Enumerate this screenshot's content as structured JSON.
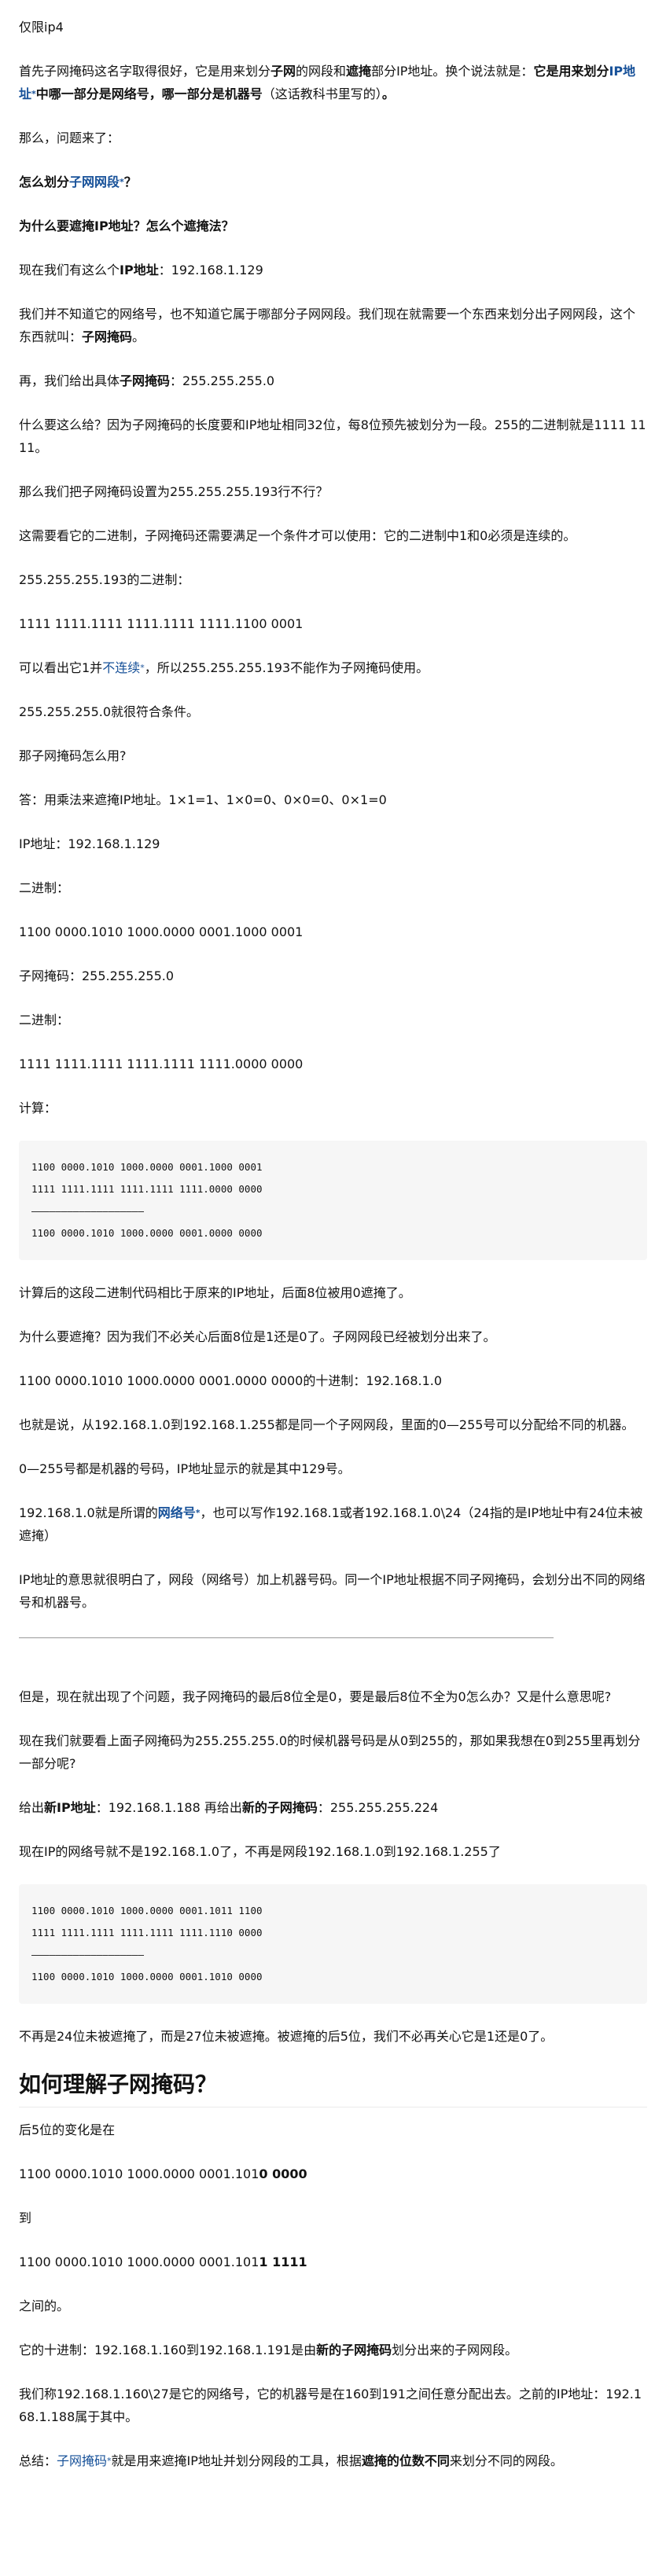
{
  "p01": "仅限ip4",
  "p02": [
    "首先子网掩码这名字取得很好，它是用来划分",
    "子网",
    "的网段和",
    "遮掩",
    "部分IP地址。换个说法就是：",
    "它是用来划分",
    "IP地址",
    "*",
    "中哪一部分是网络号，哪一部分是机器号",
    "（这话教科书里写的）",
    "。"
  ],
  "p03": "那么，问题来了：",
  "p04": [
    "怎么划分",
    "子网网段",
    "*",
    "？"
  ],
  "p05": "为什么要遮掩IP地址？怎么个遮掩法？",
  "p06": [
    "现在我们有这么个",
    "IP地址",
    "：192.168.1.129"
  ],
  "p07": [
    "我们并不知道它的网络号，也不知道它属于哪部分子网网段。我们现在就需要一个东西来划分出子网网段，这个东西就叫：",
    "子网掩码",
    "。"
  ],
  "p08": [
    "再，我们给出具体",
    "子网掩码",
    "：255.255.255.0"
  ],
  "p09": "什么要这么给？因为子网掩码的长度要和IP地址相同32位，每8位预先被划分为一段。255的二进制就是1111 1111。",
  "p10": "那么我们把子网掩码设置为255.255.255.193行不行？",
  "p11": "这需要看它的二进制，子网掩码还需要满足一个条件才可以使用：它的二进制中1和0必须是连续的。",
  "p12": "255.255.255.193的二进制：",
  "p13": "1111 1111.1111 1111.1111 1111.1100 0001",
  "p14": [
    "可以看出它1并",
    "不连续",
    "*",
    "，所以255.255.255.193不能作为子网掩码使用。"
  ],
  "p15": "255.255.255.0就很符合条件。",
  "p16": "那子网掩码怎么用?",
  "p17": "答：用乘法来遮掩IP地址。1×1=1、1×0=0、0×0=0、0×1=0",
  "p18": "IP地址：192.168.1.129",
  "p19": "二进制：",
  "p20": "1100 0000.1010 1000.0000 0001.1000 0001",
  "p21": "子网掩码：255.255.255.0",
  "p22": "二进制：",
  "p23": "1111 1111.1111 1111.1111 1111.0000 0000",
  "p24": "计算：",
  "code1": "1100 0000.1010 1000.0000 0001.1000 0001\n1111 1111.1111 1111.1111 1111.0000 0000\n———————————————————\n1100 0000.1010 1000.0000 0001.0000 0000",
  "p25": "计算后的这段二进制代码相比于原来的IP地址，后面8位被用0遮掩了。",
  "p26": "为什么要遮掩？因为我们不必关心后面8位是1还是0了。子网网段已经被划分出来了。",
  "p27": "1100 0000.1010 1000.0000 0001.0000 0000的十进制：192.168.1.0",
  "p28": "也就是说，从192.168.1.0到192.168.1.255都是同一个子网网段，里面的0—255号可以分配给不同的机器。",
  "p29": "0—255号都是机器的号码，IP地址显示的就是其中129号。",
  "p30": [
    "192.168.1.0就是所谓的",
    "网络号",
    "*",
    "，也可以写作192.168.1或者192.168.1.0\\24（24指的是IP地址中有24位未被遮掩）"
  ],
  "p31": "IP地址的意思就很明白了，网段（网络号）加上机器号码。同一个IP地址根据不同子网掩码，会划分出不同的网络号和机器号。",
  "p32": "但是，现在就出现了个问题，我子网掩码的最后8位全是0，要是最后8位不全为0怎么办？又是什么意思呢?",
  "p33": "现在我们就要看上面子网掩码为255.255.255.0的时候机器号码是从0到255的，那如果我想在0到255里再划分一部分呢?",
  "p34": [
    "给出",
    "新IP地址",
    "：192.168.1.188 再给出",
    "新的子网掩码",
    "：255.255.255.224"
  ],
  "p35": "现在IP的网络号就不是192.168.1.0了，不再是网段192.168.1.0到192.168.1.255了",
  "code2": "1100 0000.1010 1000.0000 0001.1011 1100\n1111 1111.1111 1111.1111 1111.1110 0000\n———————————————————\n1100 0000.1010 1000.0000 0001.1010 0000",
  "p36": "不再是24位未被遮掩了，而是27位未被遮掩。被遮掩的后5位，我们不必再关心它是1还是0了。",
  "heading": "如何理解子网掩码？",
  "p37": "后5位的变化是在",
  "p38": [
    "1100 0000.1010 1000.0000 0001.101",
    "0 0000"
  ],
  "p39": "到",
  "p40": [
    "1100 0000.1010 1000.0000 0001.101",
    "1 1111"
  ],
  "p41": "之间的。",
  "p42": [
    "它的十进制：192.168.1.160到192.168.1.191是由",
    "新的子网掩码",
    "划分出来的子网网段。"
  ],
  "p43": "我们称192.168.1.160\\27是它的网络号，它的机器号是在160到191之间任意分配出去。之前的IP地址：192.168.1.188属于其中。",
  "p44": [
    "总结：",
    "子网掩码",
    "*",
    "就是用来遮掩IP地址并划分网段的工具，根据",
    "遮掩的位数不同",
    "来划分不同的网段。"
  ]
}
